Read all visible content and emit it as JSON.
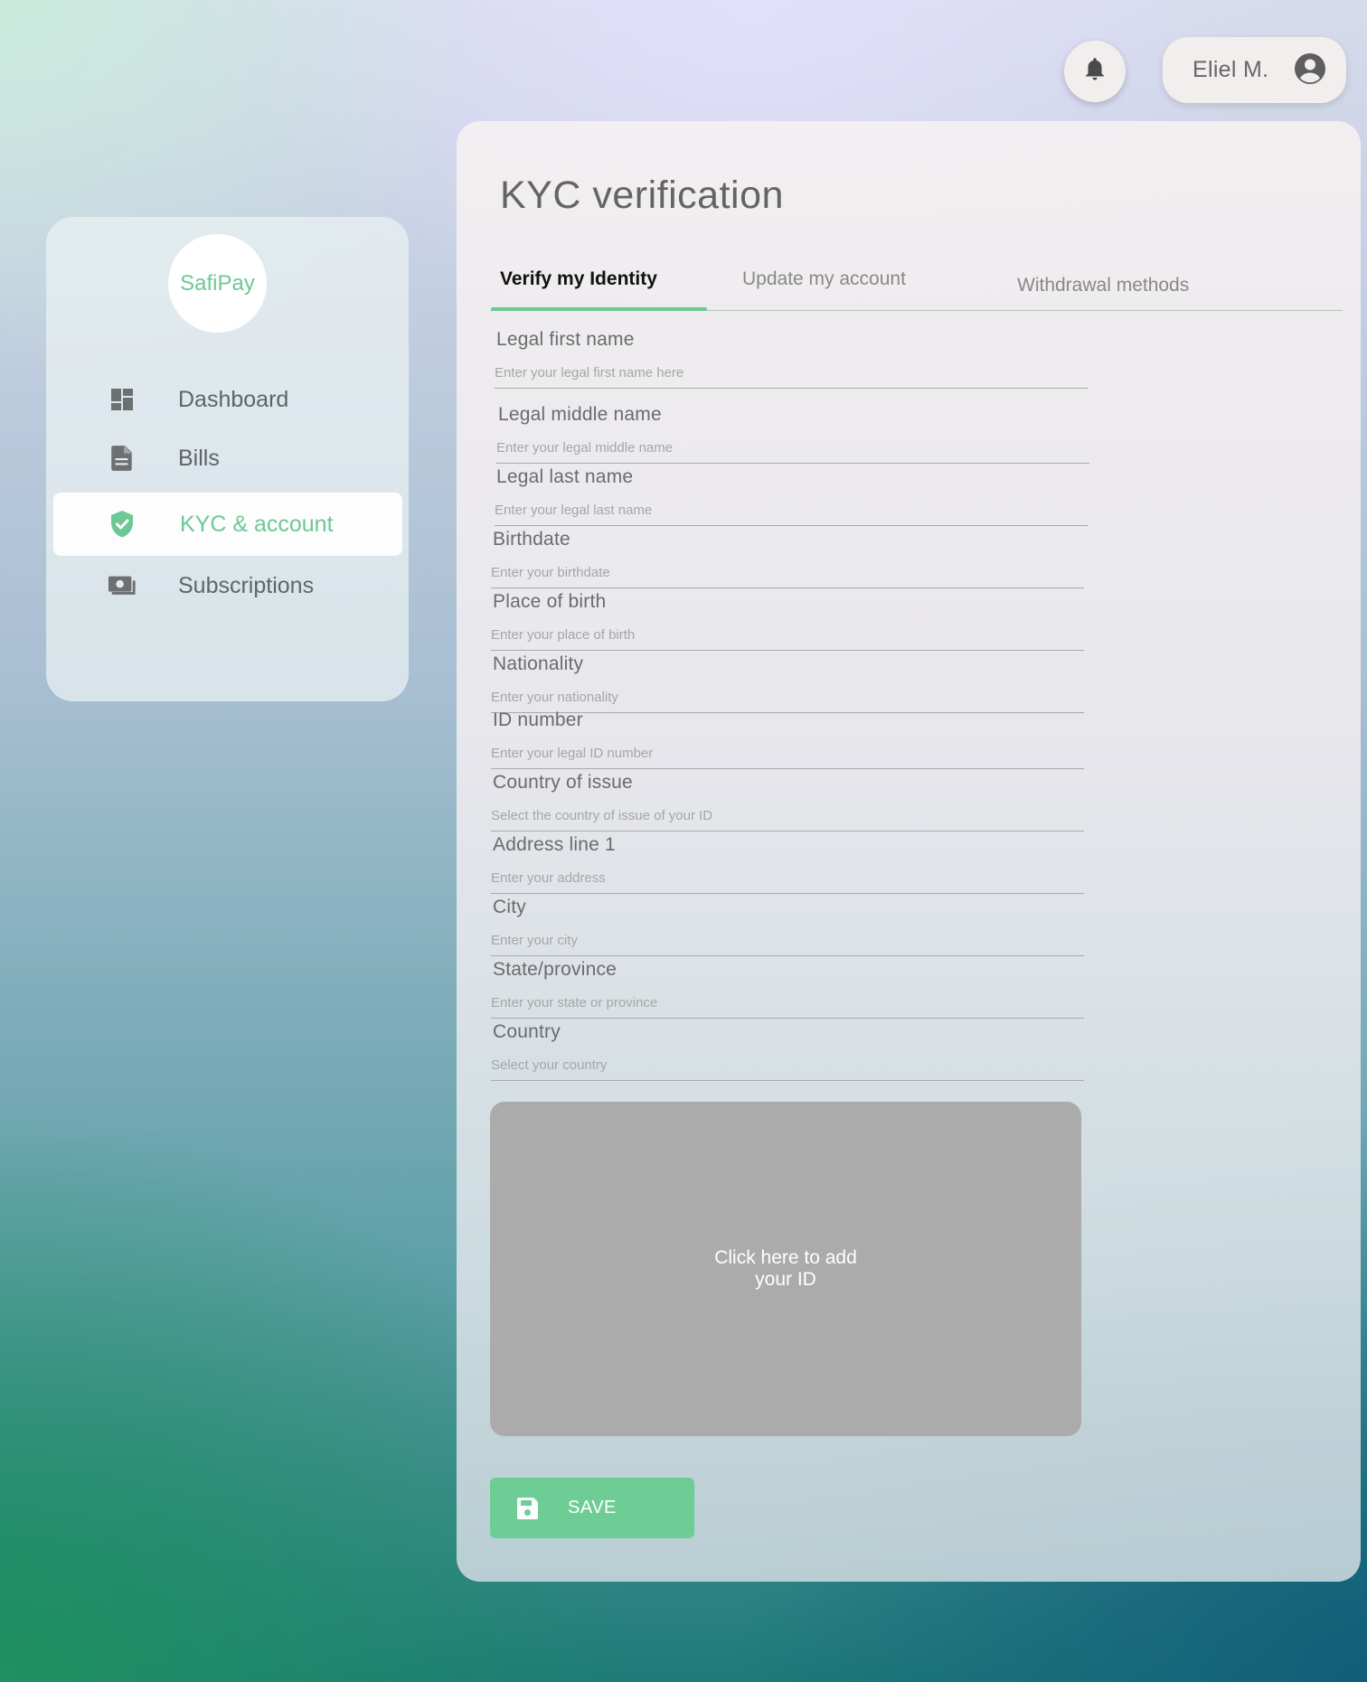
{
  "header": {
    "notifications_icon": "bell-icon",
    "user_name": "Eliel M.",
    "user_icon": "user-circle-icon"
  },
  "sidebar": {
    "logo_text": "SafiPay",
    "items": [
      {
        "label": "Dashboard",
        "icon": "dashboard-icon",
        "active": false
      },
      {
        "label": "Bills",
        "icon": "document-icon",
        "active": false
      },
      {
        "label": "KYC & account",
        "icon": "shield-check-icon",
        "active": true
      },
      {
        "label": "Subscriptions",
        "icon": "money-icon",
        "active": false
      }
    ]
  },
  "main": {
    "title": "KYC verification",
    "tabs": [
      {
        "label": "Verify my Identity",
        "active": true
      },
      {
        "label": "Update my account",
        "active": false
      },
      {
        "label": "Withdrawal methods",
        "active": false
      }
    ],
    "fields": [
      {
        "label": "Legal first name",
        "placeholder": "Enter your legal first name here",
        "value": ""
      },
      {
        "label": "Legal middle name",
        "placeholder": "Enter your legal middle name",
        "value": ""
      },
      {
        "label": "Legal last name",
        "placeholder": "Enter your legal last name",
        "value": ""
      },
      {
        "label": "Birthdate",
        "placeholder": "Enter your birthdate",
        "value": ""
      },
      {
        "label": "Place of birth",
        "placeholder": "Enter your place of birth",
        "value": ""
      },
      {
        "label": "Nationality",
        "placeholder": "Enter your nationality",
        "value": ""
      },
      {
        "label": "ID number",
        "placeholder": "Enter your legal ID number",
        "value": ""
      },
      {
        "label": "Country of issue",
        "placeholder": "Select the country of issue of your ID",
        "value": ""
      },
      {
        "label": "Address line 1",
        "placeholder": "Enter your address",
        "value": ""
      },
      {
        "label": "City",
        "placeholder": "Enter your city",
        "value": ""
      },
      {
        "label": "State/province",
        "placeholder": "Enter your state or province",
        "value": ""
      },
      {
        "label": "Country",
        "placeholder": "Select your country",
        "value": ""
      }
    ],
    "upload_text": "Click here to add your ID",
    "save_label": "SAVE",
    "save_icon": "floppy-disk-icon"
  },
  "colors": {
    "accent": "#6cc894",
    "upload_box": "#ababab",
    "card_bg": "#f3eff1"
  }
}
